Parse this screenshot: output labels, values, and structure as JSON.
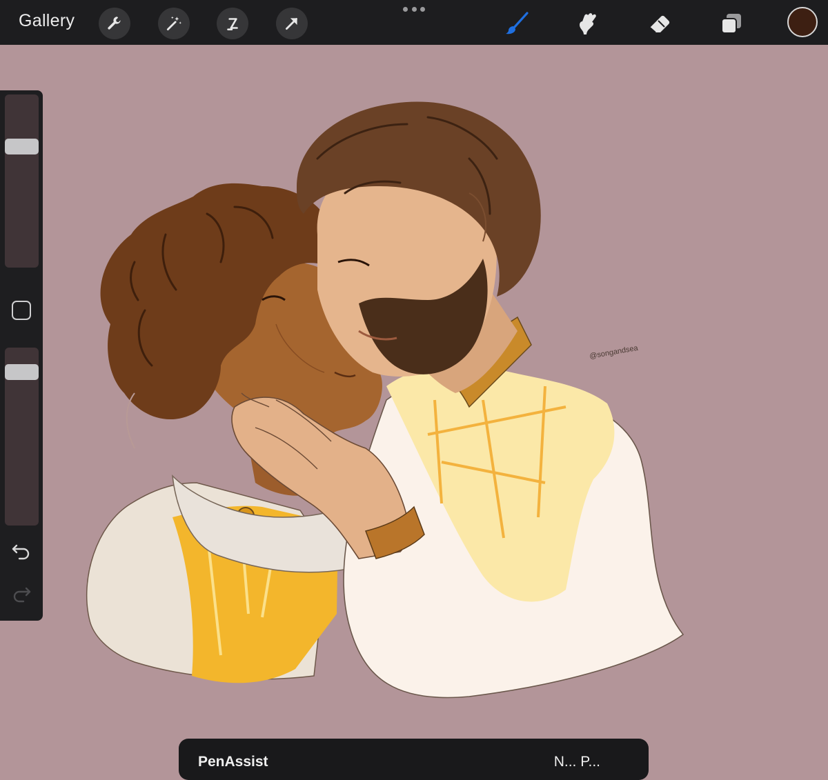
{
  "app": {
    "gallery_label": "Gallery"
  },
  "toolbar": {
    "left_tools": [
      "wrench-icon",
      "magic-wand-icon",
      "selection-icon",
      "transform-arrow-icon"
    ],
    "right_tools": [
      "brush-icon",
      "smudge-icon",
      "eraser-icon",
      "layers-icon"
    ],
    "active_tool": "brush-icon",
    "active_tool_color": "#1f6fe0",
    "current_color": "#3d1f12"
  },
  "sidebar": {
    "brush_size_level": 0.72,
    "opacity_level": 0.9
  },
  "canvas": {
    "background_color": "#b39599",
    "signature": "@songandsea"
  },
  "toast": {
    "title": "PenAssist",
    "right_text": "N... P..."
  }
}
